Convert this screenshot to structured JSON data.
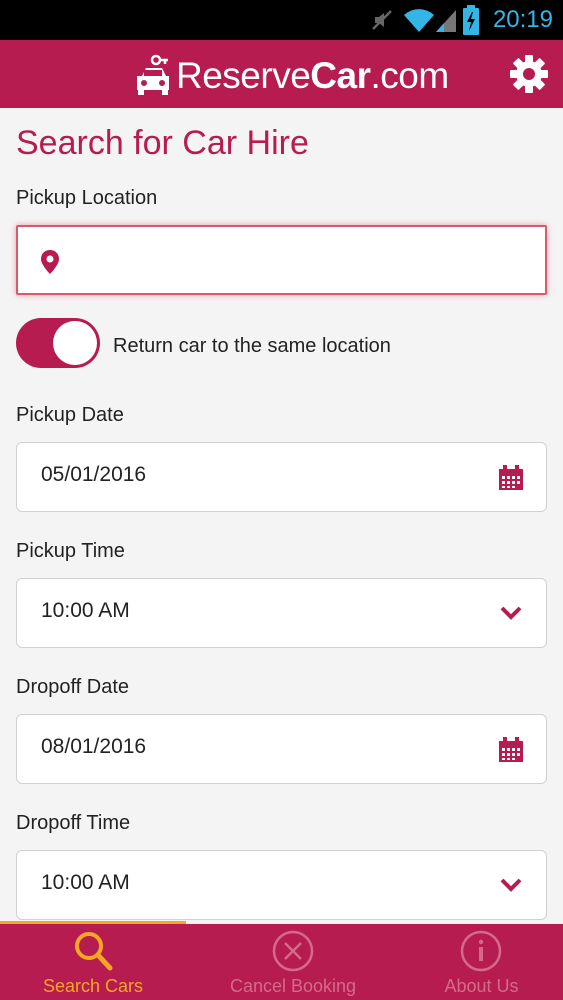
{
  "status_bar": {
    "time": "20:19"
  },
  "app_header": {
    "brand_prefix": "Reserve",
    "brand_bold": "Car",
    "brand_suffix": ".com"
  },
  "form": {
    "title": "Search for Car Hire",
    "pickup_location": {
      "label": "Pickup Location",
      "value": ""
    },
    "return_same_location": {
      "label": "Return car to the same location",
      "on": true
    },
    "pickup_date": {
      "label": "Pickup Date",
      "value": "05/01/2016"
    },
    "pickup_time": {
      "label": "Pickup Time",
      "value": "10:00 AM"
    },
    "dropoff_date": {
      "label": "Dropoff Date",
      "value": "08/01/2016"
    },
    "dropoff_time": {
      "label": "Dropoff Time",
      "value": "10:00 AM"
    }
  },
  "bottom_nav": {
    "tabs": [
      {
        "label": "Search Cars",
        "icon": "search-icon",
        "active": true
      },
      {
        "label": "Cancel Booking",
        "icon": "cancel-circle-icon",
        "active": false
      },
      {
        "label": "About Us",
        "icon": "info-circle-icon",
        "active": false
      }
    ]
  },
  "colors": {
    "primary": "#b71c50",
    "accent": "#f5a623",
    "inactive_tab": "#d46a8a",
    "status_clock": "#33b5e5"
  }
}
